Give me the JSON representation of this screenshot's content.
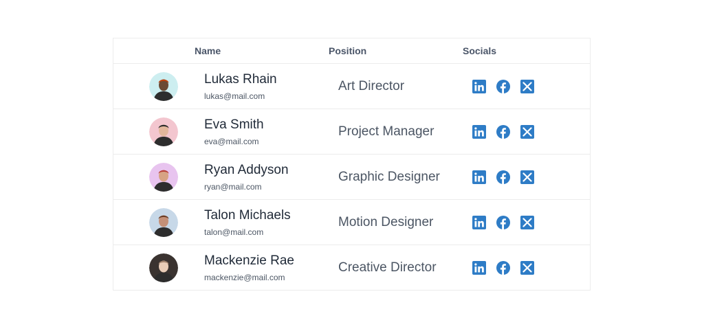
{
  "table": {
    "headers": {
      "name": "Name",
      "position": "Position",
      "socials": "Socials"
    },
    "rows": [
      {
        "name": "Lukas Rhain",
        "email": "lukas@mail.com",
        "position": "Art Director",
        "avatar_bg": "#cdeef0",
        "skin": "#6b4a34",
        "hair": "#c2410c"
      },
      {
        "name": "Eva Smith",
        "email": "eva@mail.com",
        "position": "Project Manager",
        "avatar_bg": "#f3c6cf",
        "skin": "#e2b79c",
        "hair": "#2b2b2b"
      },
      {
        "name": "Ryan Addyson",
        "email": "ryan@mail.com",
        "position": "Graphic Designer",
        "avatar_bg": "#e8c4ef",
        "skin": "#d7a383",
        "hair": "#b8403a"
      },
      {
        "name": "Talon Michaels",
        "email": "talon@mail.com",
        "position": "Motion Designer",
        "avatar_bg": "#c7d8e8",
        "skin": "#c59077",
        "hair": "#6b3d26"
      },
      {
        "name": "Mackenzie Rae",
        "email": "mackenzie@mail.com",
        "position": "Creative Director",
        "avatar_bg": "#3a3330",
        "skin": "#e9cdb8",
        "hair": "#a0826d"
      }
    ],
    "socials": [
      "linkedin-icon",
      "facebook-icon",
      "x-twitter-icon"
    ]
  },
  "colors": {
    "social_blue": "#2e7cc6"
  }
}
